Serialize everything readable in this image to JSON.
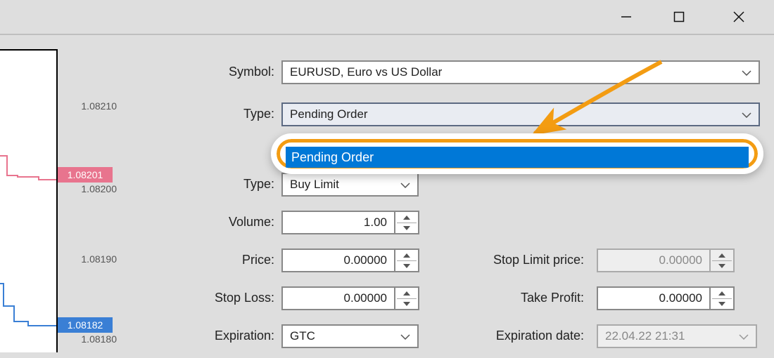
{
  "titlebar": {
    "min_icon": "minimize-icon",
    "max_icon": "maximize-icon",
    "close_icon": "close-icon"
  },
  "chart_ticks": {
    "t1": "1.08210",
    "tag1": "1.08201",
    "t2": "1.08200",
    "t3": "1.08190",
    "tag2": "1.08182",
    "t4": "1.08180"
  },
  "form": {
    "symbol_label": "Symbol:",
    "symbol_value": "EURUSD, Euro vs US Dollar",
    "type1_label": "Type:",
    "type1_value": "Pending Order",
    "type2_label": "Type:",
    "type2_value": "Buy Limit",
    "volume_label": "Volume:",
    "volume_value": "1.00",
    "price_label": "Price:",
    "price_value": "0.00000",
    "stoploss_label": "Stop Loss:",
    "stoploss_value": "0.00000",
    "expiration_label": "Expiration:",
    "expiration_value": "GTC",
    "stoplimit_label": "Stop Limit price:",
    "stoplimit_value": "0.00000",
    "takeprofit_label": "Take Profit:",
    "takeprofit_value": "0.00000",
    "expdate_label": "Expiration date:",
    "expdate_value": "22.04.22 21:31"
  },
  "dropdown": {
    "highlighted": "Pending Order"
  },
  "colors": {
    "highlight_orange": "#f39c12",
    "selection_blue": "#0078d7",
    "ask_tag": "#e8748e",
    "bid_tag": "#3a7fd5"
  }
}
